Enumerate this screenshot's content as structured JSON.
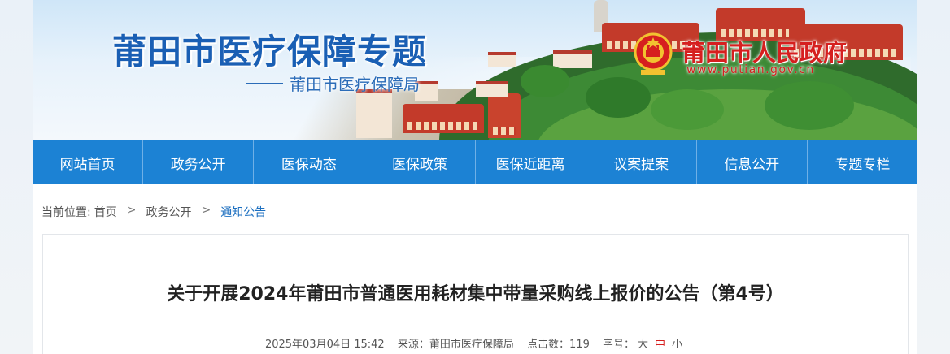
{
  "banner": {
    "title": "莆田市医疗保障专题",
    "subtitle": "莆田市医疗保障局",
    "gov_name": "莆田市人民政府",
    "gov_url": "www.putian.gov.cn",
    "emblem_icon": "national-emblem-icon"
  },
  "nav": {
    "items": [
      {
        "label": "网站首页"
      },
      {
        "label": "政务公开"
      },
      {
        "label": "医保动态"
      },
      {
        "label": "医保政策"
      },
      {
        "label": "医保近距离"
      },
      {
        "label": "议案提案"
      },
      {
        "label": "信息公开"
      },
      {
        "label": "专题专栏"
      }
    ]
  },
  "breadcrumb": {
    "prefix": "当前位置:",
    "home": "首页",
    "level1": "政务公开",
    "current": "通知公告",
    "separator": ">"
  },
  "article": {
    "title": "关于开展2024年莆田市普通医用耗材集中带量采购线上报价的公告（第4号）",
    "date": "2025年03月04日 15:42",
    "source_label": "来源：",
    "source": "莆田市医疗保障局",
    "clicks_label": "点击数：",
    "clicks": "119",
    "font_label": "字号：",
    "font_large": "大",
    "font_medium": "中",
    "font_small": "小"
  },
  "colors": {
    "nav_bg": "#1c82d4",
    "title_blue": "#1a5fb4",
    "gov_red": "#d61f1f",
    "breadcrumb_current": "#1c6fc0"
  }
}
